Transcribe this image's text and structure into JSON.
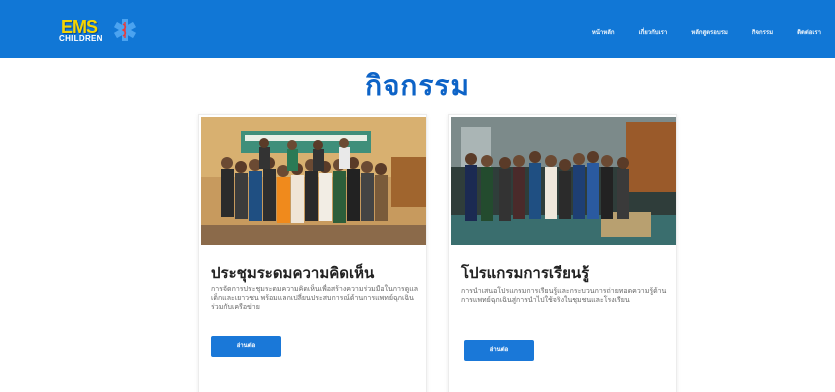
{
  "header": {
    "logo_main": "EMS",
    "logo_sub": "CHILDREN",
    "nav": [
      "หน้าหลัก",
      "เกี่ยวกับเรา",
      "หลักสูตรอบรม",
      "กิจกรรม",
      "ติดต่อเรา"
    ]
  },
  "page_title": "กิจกรรม",
  "cards": [
    {
      "title": "ประชุมระดมความคิดเห็น",
      "description": "การจัดการประชุมระดมความคิดเห็นเพื่อสร้างความร่วมมือในการดูแลเด็กและเยาวชน พร้อมแลกเปลี่ยนประสบการณ์ด้านการแพทย์ฉุกเฉินร่วมกับเครือข่าย",
      "button": "อ่านต่อ"
    },
    {
      "title": "โปรแกรมการเรียนรู้",
      "description": "การนำเสนอโปรแกรมการเรียนรู้และกระบวนการถ่ายทอดความรู้ด้านการแพทย์ฉุกเฉินสู่การนำไปใช้จริงในชุมชนและโรงเรียน",
      "button": "อ่านต่อ"
    }
  ],
  "colors": {
    "header_bg": "#1177d6",
    "title": "#0d63c7",
    "button": "#1a78d8"
  }
}
